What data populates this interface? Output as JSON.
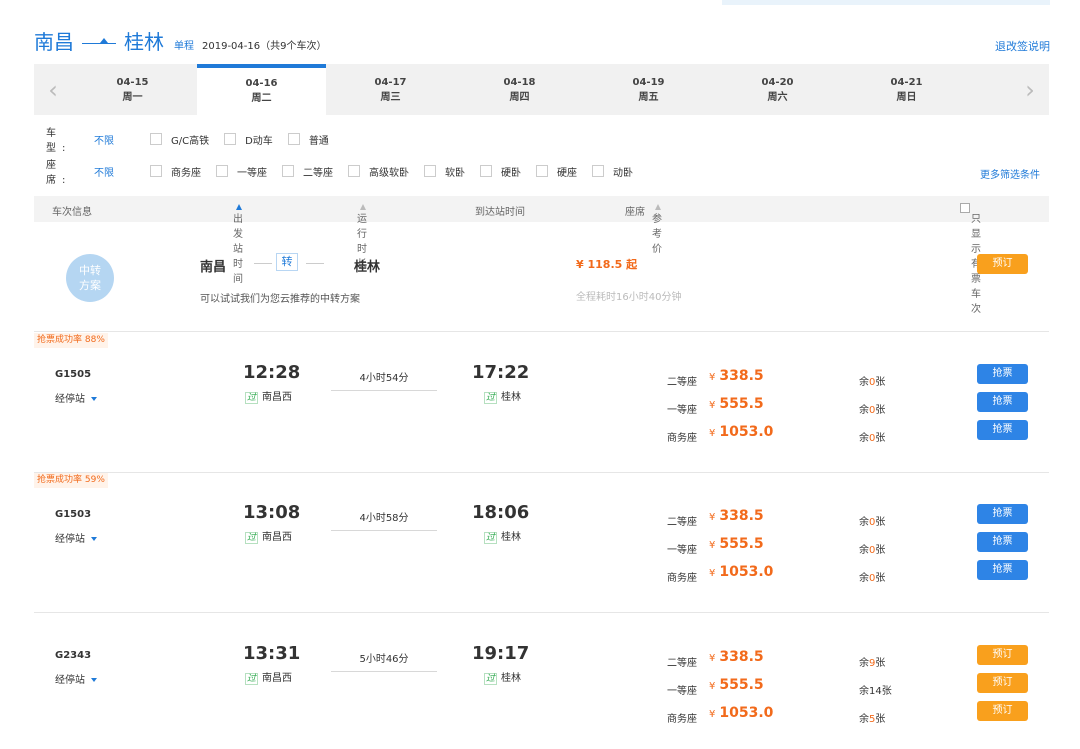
{
  "route": {
    "from": "南昌",
    "to": "桂林",
    "trip_type": "单程",
    "date_info": "2019-04-16（共9个车次）",
    "refund_link": "退改签说明"
  },
  "date_tabs": [
    {
      "date": "04-15",
      "weekday": "周一"
    },
    {
      "date": "04-16",
      "weekday": "周二",
      "active": true
    },
    {
      "date": "04-17",
      "weekday": "周三"
    },
    {
      "date": "04-18",
      "weekday": "周四"
    },
    {
      "date": "04-19",
      "weekday": "周五"
    },
    {
      "date": "04-20",
      "weekday": "周六"
    },
    {
      "date": "04-21",
      "weekday": "周日"
    }
  ],
  "filters": {
    "train_type": {
      "label": "车 型:",
      "all": "不限",
      "options": [
        "G/C高铁",
        "D动车",
        "普通"
      ]
    },
    "seat_type": {
      "label": "座 席:",
      "all": "不限",
      "options": [
        "商务座",
        "一等座",
        "二等座",
        "高级软卧",
        "软卧",
        "硬卧",
        "硬座",
        "动卧"
      ]
    },
    "more": "更多筛选条件"
  },
  "columns": {
    "train_info": "车次信息",
    "dep_time": "出发站时间",
    "duration": "运行时长",
    "arr_time": "到达站时间",
    "seat": "座席",
    "ref_price": "参考价",
    "only_available": "只显示有票车次"
  },
  "transfer": {
    "badge_line1": "中转",
    "badge_line2": "方案",
    "from": "南昌",
    "mid": "转",
    "to": "桂林",
    "hint": "可以试试我们为您云推荐的中转方案",
    "price": "¥ 118.5 起",
    "total_duration": "全程耗时16小时40分钟",
    "button": "预订"
  },
  "trains": [
    {
      "success_rate": "抢票成功率 88%",
      "number": "G1505",
      "stops": "经停站",
      "dep_time": "12:28",
      "pass_tag": "过",
      "dep_station": "南昌西",
      "duration": "4小时54分",
      "arr_time": "17:22",
      "arr_station": "桂林",
      "seats": [
        {
          "name": "二等座",
          "yen": "¥",
          "price": "338.5",
          "left_pre": "余",
          "left_num": "0",
          "left_post": "张",
          "button": "抢票"
        },
        {
          "name": "一等座",
          "yen": "¥",
          "price": "555.5",
          "left_pre": "余",
          "left_num": "0",
          "left_post": "张",
          "button": "抢票"
        },
        {
          "name": "商务座",
          "yen": "¥",
          "price": "1053.0",
          "left_pre": "余",
          "left_num": "0",
          "left_post": "张",
          "button": "抢票"
        }
      ]
    },
    {
      "success_rate": "抢票成功率 59%",
      "number": "G1503",
      "stops": "经停站",
      "dep_time": "13:08",
      "pass_tag": "过",
      "dep_station": "南昌西",
      "duration": "4小时58分",
      "arr_time": "18:06",
      "arr_station": "桂林",
      "seats": [
        {
          "name": "二等座",
          "yen": "¥",
          "price": "338.5",
          "left_pre": "余",
          "left_num": "0",
          "left_post": "张",
          "button": "抢票"
        },
        {
          "name": "一等座",
          "yen": "¥",
          "price": "555.5",
          "left_pre": "余",
          "left_num": "0",
          "left_post": "张",
          "button": "抢票"
        },
        {
          "name": "商务座",
          "yen": "¥",
          "price": "1053.0",
          "left_pre": "余",
          "left_num": "0",
          "left_post": "张",
          "button": "抢票"
        }
      ]
    },
    {
      "success_rate": "",
      "number": "G2343",
      "stops": "经停站",
      "dep_time": "13:31",
      "pass_tag": "过",
      "dep_station": "南昌西",
      "duration": "5小时46分",
      "arr_time": "19:17",
      "arr_station": "桂林",
      "seats": [
        {
          "name": "二等座",
          "yen": "¥",
          "price": "338.5",
          "left_pre": "余",
          "left_num": "9",
          "left_post": "张",
          "button": "预订"
        },
        {
          "name": "一等座",
          "yen": "¥",
          "price": "555.5",
          "left_pre": "余",
          "left_num": "14",
          "left_post": "张",
          "button": "预订"
        },
        {
          "name": "商务座",
          "yen": "¥",
          "price": "1053.0",
          "left_pre": "余",
          "left_num": "5",
          "left_post": "张",
          "button": "预订"
        }
      ]
    }
  ]
}
